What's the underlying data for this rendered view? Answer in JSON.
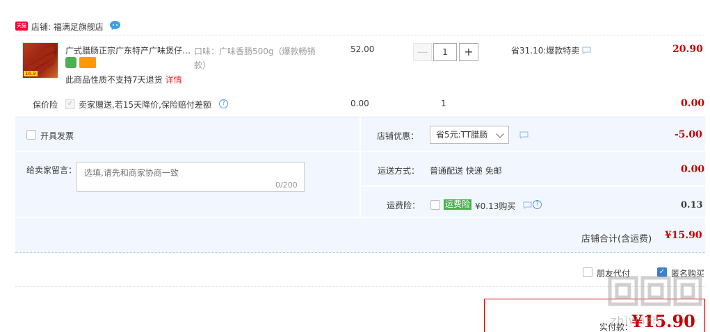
{
  "shop": {
    "logo_text": "天猫",
    "label": "店铺: 福满足旗舰店"
  },
  "item": {
    "title": "广式腊肠正宗广东特产广味煲仔…",
    "sku": "口味：广味香肠500g（爆款畅销款）",
    "policy": "此商品性质不支持7天退货",
    "policy_link": "详情",
    "unit_price": "52.00",
    "quantity": "1",
    "minus": "—",
    "plus": "+",
    "discount": "省31.10:爆款特卖",
    "subtotal": "20.90",
    "thumb_tag": "16.9"
  },
  "insurance": {
    "label": "保价险",
    "text": "卖家赠送,若15天降价,保险赔付差额",
    "price": "0.00",
    "qty": "1",
    "subtotal": "0.00"
  },
  "options": {
    "invoice_label": "开具发票",
    "message_label": "给卖家留言：",
    "message_placeholder": "选填,请先和商家协商一致",
    "message_count": "0/200",
    "shop_discount_label": "店铺优惠：",
    "shop_discount_selected": "省5元:TT腊肠",
    "shop_discount_value": "-5.00",
    "shipping_label": "运送方式：",
    "shipping_value": "普通配送 快递 免邮",
    "shipping_price": "0.00",
    "freight_ins_label": "运费险：",
    "freight_ins_tag": "运费险",
    "freight_ins_text": "¥0.13购买",
    "freight_ins_price": "0.13",
    "total_label": "店铺合计(含运费)",
    "total_value": "¥15.90"
  },
  "footer": {
    "friend_pay_label": "朋友代付",
    "anonymous_label": "匿名购买",
    "pay_label": "实付款：",
    "pay_value": "¥15.90",
    "watermark": "zhiwazhi"
  },
  "colors": {
    "accent_red": "#c40000",
    "panel_bg": "#f2f7ff",
    "check_blue": "#3d7fcf"
  }
}
